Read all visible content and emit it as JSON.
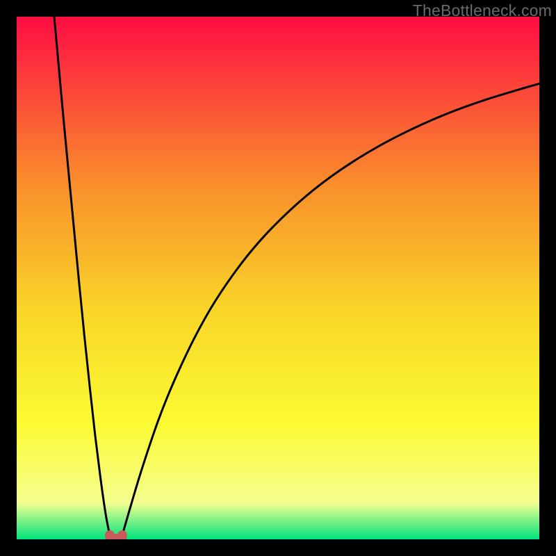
{
  "attribution": "TheBottleneck.com",
  "colors": {
    "gradient_top": "#fe0d44",
    "gradient_upper_mid": "#f98e2c",
    "gradient_mid": "#f9d528",
    "gradient_lower_mid": "#fbfb33",
    "gradient_lower": "#f4fe8f",
    "gradient_bottom": "#00e47e",
    "curve": "#000000",
    "marker": "#c85a5e",
    "frame": "#000000"
  },
  "chart_data": {
    "type": "line",
    "title": "",
    "xlabel": "",
    "ylabel": "",
    "xlim": [
      0,
      100
    ],
    "ylim": [
      0,
      100
    ],
    "series": [
      {
        "name": "left-branch",
        "x": [
          7.18,
          8,
          9,
          10,
          11,
          12,
          13,
          14,
          15,
          16,
          17,
          17.8
        ],
        "y": [
          100,
          91,
          80,
          69.5,
          59,
          48.5,
          38.5,
          29,
          20,
          12,
          5,
          0.8
        ]
      },
      {
        "name": "right-branch",
        "x": [
          20.2,
          22,
          24,
          27,
          30,
          34,
          38,
          43,
          48,
          54,
          60,
          67,
          74,
          82,
          90,
          100
        ],
        "y": [
          0.8,
          7,
          13.6,
          22.5,
          30,
          38.5,
          45.6,
          52.8,
          58.7,
          64.5,
          69.3,
          73.9,
          77.7,
          81.3,
          84.2,
          87.2
        ]
      }
    ],
    "markers": [
      {
        "name": "optimum-left",
        "x": 17.8,
        "y": 0.8
      },
      {
        "name": "optimum-mid",
        "x": 19.0,
        "y": 0.1
      },
      {
        "name": "optimum-right",
        "x": 20.2,
        "y": 0.8
      }
    ]
  }
}
